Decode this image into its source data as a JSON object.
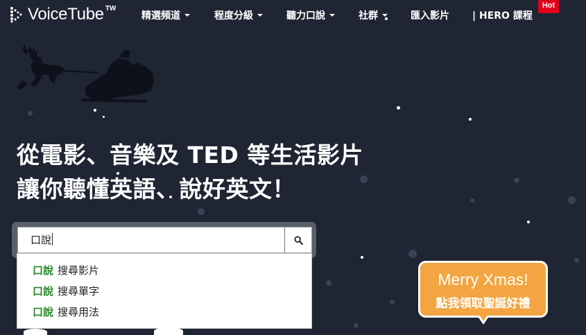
{
  "brand": {
    "name": "VoiceTube",
    "superscript": "TW"
  },
  "nav": {
    "items": [
      {
        "label": "精選頻道",
        "dropdown": true
      },
      {
        "label": "程度分級",
        "dropdown": true
      },
      {
        "label": "聽力口說",
        "dropdown": true
      },
      {
        "label": "社群",
        "dropdown": true
      },
      {
        "label": "匯入影片",
        "dropdown": false
      },
      {
        "label": "|  HERO 課程",
        "dropdown": false
      }
    ],
    "hot_badge": "Hot"
  },
  "hero": {
    "line1": "從電影、音樂及 TED 等生活影片",
    "line2": "讓你聽懂英語、說好英文！"
  },
  "search": {
    "value": "口說",
    "icon": "search-icon",
    "suggestions": [
      {
        "keyword": "口說",
        "label": "搜尋影片"
      },
      {
        "keyword": "口說",
        "label": "搜尋單字"
      },
      {
        "keyword": "口說",
        "label": "搜尋用法"
      }
    ]
  },
  "promo": {
    "line1": "Merry Xmas!",
    "line2": "點我領取聖誕好禮"
  },
  "colors": {
    "background": "#1f2533",
    "hot_badge": "#e3001b",
    "suggestion_keyword": "#2a8a2a",
    "promo_bubble": "#f2a541"
  }
}
